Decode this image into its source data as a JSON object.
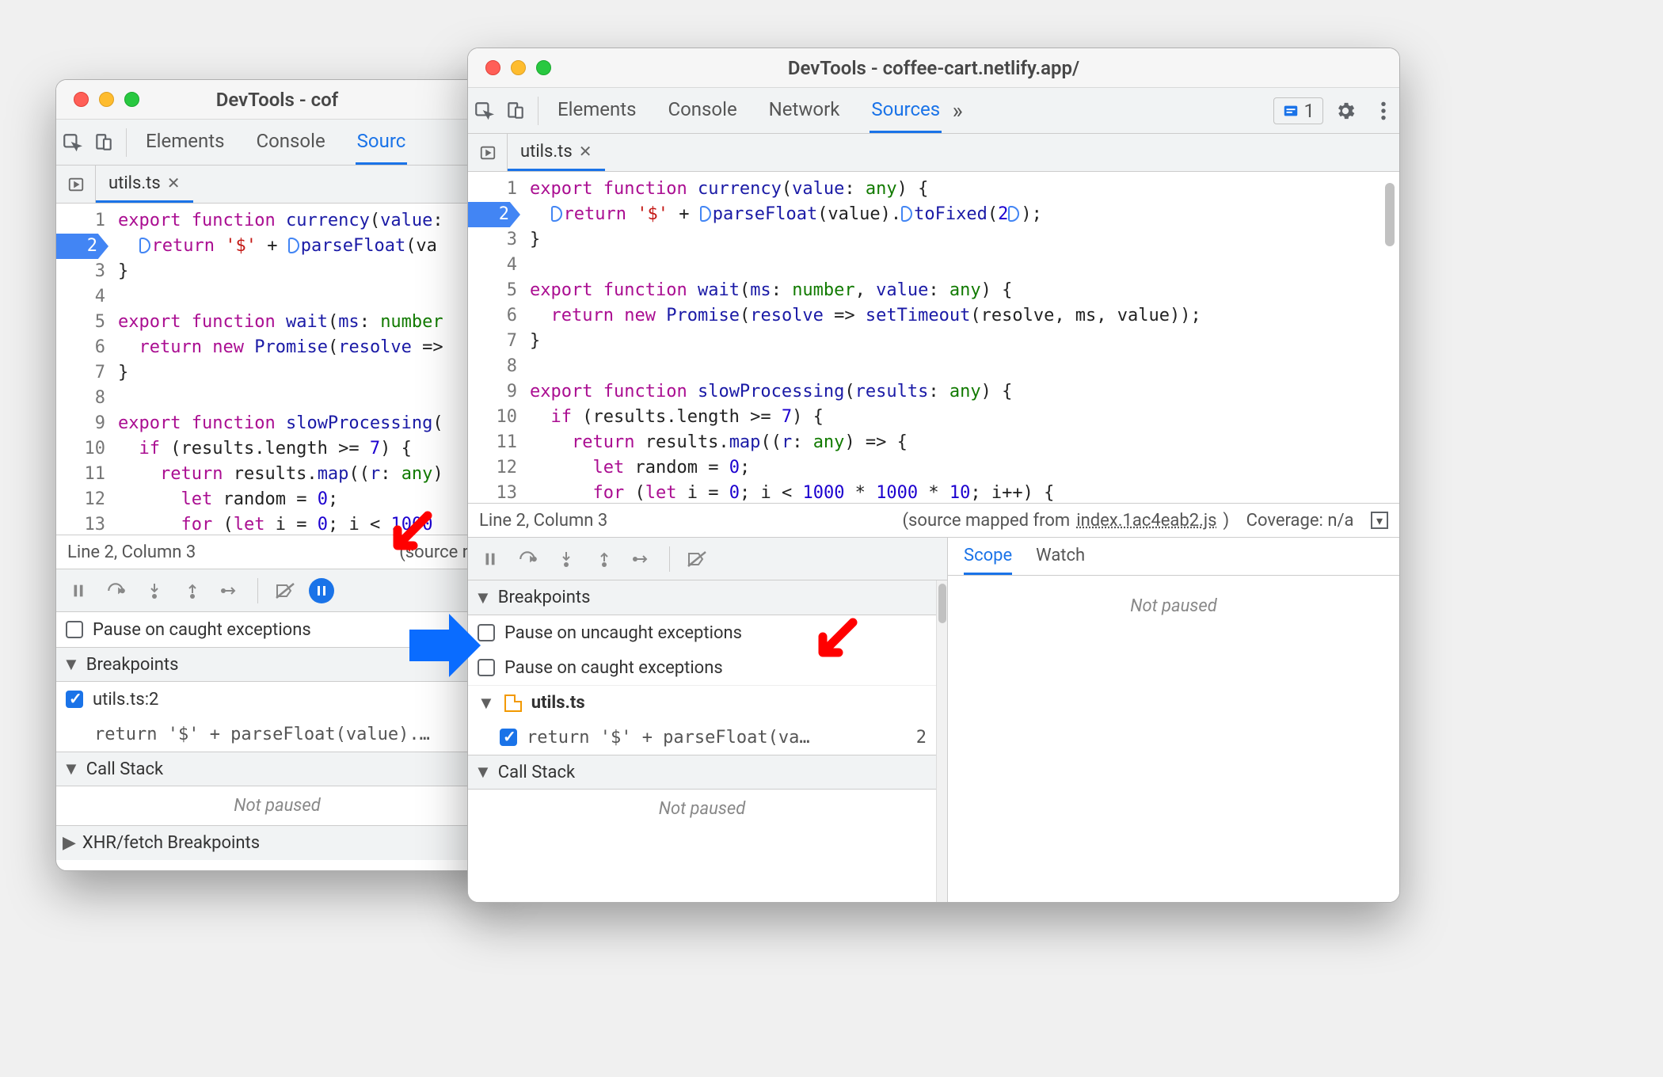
{
  "window_left": {
    "title": "DevTools - cof",
    "tabs": [
      "Elements",
      "Console",
      "Sourc"
    ],
    "active_tab_index": 2,
    "file_tab": "utils.ts",
    "code_lines": [
      {
        "n": 1,
        "html": "<span class='kw'>export</span> <span class='kw'>function</span> <span class='fn'>currency</span>(<span class='fn'>value</span>:"
      },
      {
        "n": 2,
        "bp": true,
        "html": "  <span class='step-marker'></span><span class='kw'>return</span> <span class='str'>'$'</span> + <span class='step-marker'></span><span class='fn'>parseFloat</span>(va"
      },
      {
        "n": 3,
        "html": "}"
      },
      {
        "n": 4,
        "html": ""
      },
      {
        "n": 5,
        "html": "<span class='kw'>export</span> <span class='kw'>function</span> <span class='fn'>wait</span>(<span class='fn'>ms</span>: <span class='ty'>number</span>"
      },
      {
        "n": 6,
        "html": "  <span class='kw'>return</span> <span class='kw'>new</span> <span class='fn'>Promise</span>(<span class='fn'>resolve</span> =>"
      },
      {
        "n": 7,
        "html": "}"
      },
      {
        "n": 8,
        "html": ""
      },
      {
        "n": 9,
        "html": "<span class='kw'>export</span> <span class='kw'>function</span> <span class='fn'>slowProcessing</span>("
      },
      {
        "n": 10,
        "html": "  <span class='kw'>if</span> (results.length &gt;= <span class='num'>7</span>) {"
      },
      {
        "n": 11,
        "html": "    <span class='kw'>return</span> results.<span class='fn'>map</span>((<span class='fn'>r</span>: <span class='ty'>any</span>)"
      },
      {
        "n": 12,
        "html": "      <span class='kw'>let</span> random = <span class='num'>0</span>;"
      },
      {
        "n": 13,
        "html": "      <span class='kw'>for</span> (<span class='kw'>let</span> i = <span class='num'>0</span>; i &lt; <span class='num'>1000</span>"
      }
    ],
    "status_left": "Line 2, Column 3",
    "status_right": "(source ma",
    "pause_caught_label": "Pause on caught exceptions",
    "breakpoints_header": "Breakpoints",
    "bp_file": "utils.ts:2",
    "bp_code": "return '$' + parseFloat(value).…",
    "callstack_header": "Call Stack",
    "not_paused": "Not paused",
    "xhr_header": "XHR/fetch Breakpoints"
  },
  "window_right": {
    "title": "DevTools - coffee-cart.netlify.app/",
    "tabs": [
      "Elements",
      "Console",
      "Network",
      "Sources"
    ],
    "active_tab_index": 3,
    "issues_count": "1",
    "file_tab": "utils.ts",
    "code_lines": [
      {
        "n": 1,
        "html": "<span class='kw'>export</span> <span class='kw'>function</span> <span class='fn'>currency</span>(<span class='fn'>value</span>: <span class='ty'>any</span>) {"
      },
      {
        "n": 2,
        "bp": true,
        "html": "  <span class='step-marker'></span><span class='kw'>return</span> <span class='str'>'$'</span> + <span class='step-marker'></span><span class='fn'>parseFloat</span>(value).<span class='step-marker'></span><span class='fn'>toFixed</span>(<span class='num'>2</span><span class='step-marker'></span>);"
      },
      {
        "n": 3,
        "html": "}"
      },
      {
        "n": 4,
        "html": ""
      },
      {
        "n": 5,
        "html": "<span class='kw'>export</span> <span class='kw'>function</span> <span class='fn'>wait</span>(<span class='fn'>ms</span>: <span class='ty'>number</span>, <span class='fn'>value</span>: <span class='ty'>any</span>) {"
      },
      {
        "n": 6,
        "html": "  <span class='kw'>return</span> <span class='kw'>new</span> <span class='fn'>Promise</span>(<span class='fn'>resolve</span> =&gt; <span class='fn'>setTimeout</span>(resolve, ms, value));"
      },
      {
        "n": 7,
        "html": "}"
      },
      {
        "n": 8,
        "html": ""
      },
      {
        "n": 9,
        "html": "<span class='kw'>export</span> <span class='kw'>function</span> <span class='fn'>slowProcessing</span>(<span class='fn'>results</span>: <span class='ty'>any</span>) {"
      },
      {
        "n": 10,
        "html": "  <span class='kw'>if</span> (results.length &gt;= <span class='num'>7</span>) {"
      },
      {
        "n": 11,
        "html": "    <span class='kw'>return</span> results.<span class='fn'>map</span>((<span class='fn'>r</span>: <span class='ty'>any</span>) =&gt; {"
      },
      {
        "n": 12,
        "html": "      <span class='kw'>let</span> random = <span class='num'>0</span>;"
      },
      {
        "n": 13,
        "html": "      <span class='kw'>for</span> (<span class='kw'>let</span> i = <span class='num'>0</span>; i &lt; <span class='num'>1000</span> * <span class='num'>1000</span> * <span class='num'>10</span>; i++) {"
      }
    ],
    "status_left": "Line 2, Column 3",
    "status_mapped_prefix": "(source mapped from ",
    "status_mapped_file": "index.1ac4eab2.js",
    "status_mapped_suffix": ")",
    "status_coverage": "Coverage: n/a",
    "breakpoints_header": "Breakpoints",
    "pause_uncaught_label": "Pause on uncaught exceptions",
    "pause_caught_label": "Pause on caught exceptions",
    "bp_group_file": "utils.ts",
    "bp_code": "return '$' + parseFloat(va…",
    "bp_line_num": "2",
    "callstack_header": "Call Stack",
    "not_paused": "Not paused",
    "scope_label": "Scope",
    "watch_label": "Watch",
    "scope_not_paused": "Not paused"
  }
}
